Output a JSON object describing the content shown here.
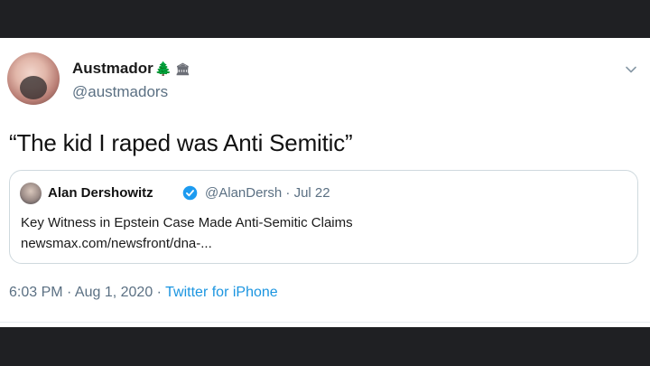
{
  "tweet": {
    "display_name": "Austmador",
    "emoji_1": "🌲",
    "emoji_2": "🏛",
    "handle": "@austmadors",
    "text": "“The kid I raped was Anti Semitic”",
    "timestamp": "6:03 PM · Aug 1, 2020 ·",
    "source": "Twitter for iPhone",
    "menu_icon": "chevron-down-icon"
  },
  "quoted": {
    "name": "Alan Dershowitz",
    "verified_icon": "verified-badge-icon",
    "handle_date": "@AlanDersh · Jul 22",
    "title": "Key Witness in Epstein Case Made Anti-Semitic Claims",
    "link": "newsmax.com/newsfront/dna-..."
  },
  "colors": {
    "page_bg": "#ffffff",
    "frame_bg": "#1f2023",
    "accent_blue": "#1b95e0",
    "secondary_text": "#5b7083",
    "border": "#cfd9de"
  }
}
